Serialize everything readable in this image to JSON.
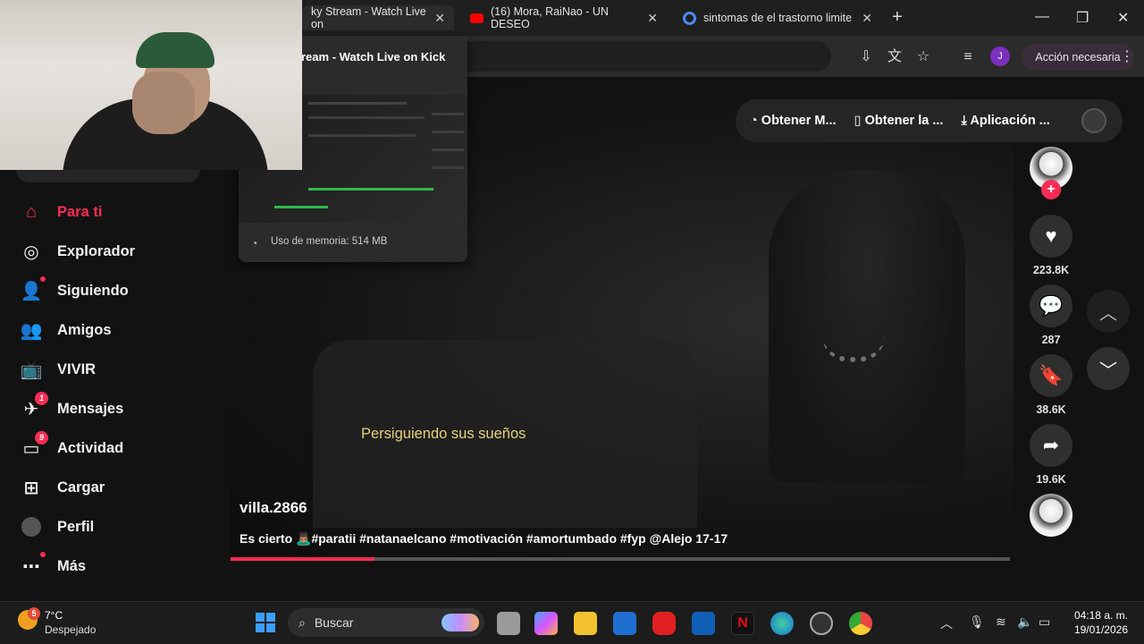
{
  "browser": {
    "tabs": [
      {
        "title": "ky Stream - Watch Live on",
        "icon": "kick-icon"
      },
      {
        "title": "(16) Mora, RaiNao - UN DESEO",
        "icon": "youtube-icon"
      },
      {
        "title": "sintomas de el trastorno limite",
        "icon": "google-icon"
      }
    ],
    "new_tab": "+",
    "profile_initial": "J",
    "action_label": "Acción necesaria"
  },
  "tab_preview": {
    "title": "ream - Watch Live on Kick",
    "memory": "Uso de memoria: 514 MB"
  },
  "sidebar": {
    "items": [
      {
        "label": "Para ti",
        "icon": "home-icon",
        "active": true
      },
      {
        "label": "Explorador",
        "icon": "compass-icon"
      },
      {
        "label": "Siguiendo",
        "icon": "following-icon",
        "dot": true
      },
      {
        "label": "Amigos",
        "icon": "friends-icon"
      },
      {
        "label": "VIVIR",
        "icon": "live-icon"
      },
      {
        "label": "Mensajes",
        "icon": "messages-icon",
        "badge": "1"
      },
      {
        "label": "Actividad",
        "icon": "activity-icon",
        "badge": "9"
      },
      {
        "label": "Cargar",
        "icon": "upload-icon"
      },
      {
        "label": "Perfil",
        "icon": "profile-icon"
      },
      {
        "label": "Más",
        "icon": "more-icon",
        "dot": true
      }
    ]
  },
  "topbar": {
    "get_coins": "Obtener M...",
    "get_app": "Obtener la ...",
    "desktop_app": "Aplicación ..."
  },
  "video": {
    "subtitle": "Persiguiendo sus sueños",
    "username": "villa.2866",
    "caption": "Es cierto 🙇🏽‍♂️#paratii #natanaelcano #motivación #amortumbado #fyp @Alejo 17-17",
    "progress": 0.185
  },
  "actions": {
    "likes": "223.8K",
    "comments": "287",
    "saves": "38.6K",
    "shares": "19.6K"
  },
  "taskbar": {
    "temperature": "7°C",
    "weather": "Despejado",
    "weather_badge": "5",
    "search_placeholder": "Buscar",
    "time": "04:18 a. m.",
    "date": "19/01/2026"
  },
  "colors": {
    "accent": "#fe2c55",
    "subtitle": "#e6d27a"
  }
}
